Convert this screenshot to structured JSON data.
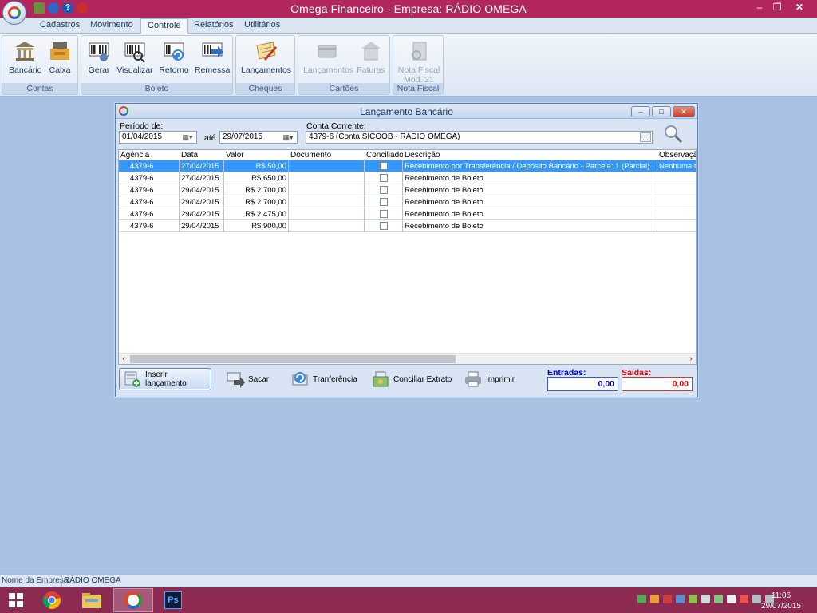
{
  "app": {
    "title": "Omega Financeiro - Empresa: RÁDIO OMEGA",
    "window_controls": [
      "–",
      "❐",
      "✕"
    ]
  },
  "menu": {
    "tabs": [
      {
        "label": "Cadastros",
        "active": false
      },
      {
        "label": "Movimento",
        "active": false
      },
      {
        "label": "Controle",
        "active": true
      },
      {
        "label": "Relatórios",
        "active": false
      },
      {
        "label": "Utilitários",
        "active": false
      }
    ]
  },
  "ribbon": {
    "groups": [
      {
        "label": "Contas",
        "buttons": [
          {
            "label": "Bancário",
            "icon": "bank-icon"
          },
          {
            "label": "Caixa",
            "icon": "cash-register-icon"
          }
        ]
      },
      {
        "label": "Boleto",
        "buttons": [
          {
            "label": "Gerar",
            "icon": "barcode-gear-icon"
          },
          {
            "label": "Visualizar",
            "icon": "barcode-magnifier-icon"
          },
          {
            "label": "Retorno",
            "icon": "barcode-refresh-icon"
          },
          {
            "label": "Remessa",
            "icon": "barcode-arrow-icon"
          }
        ]
      },
      {
        "label": "Cheques",
        "buttons": [
          {
            "label": "Lançamentos",
            "icon": "check-pen-icon"
          }
        ]
      },
      {
        "label": "Cartões",
        "buttons": [
          {
            "label": "Lançamentos",
            "icon": "card-icon",
            "disabled": true
          },
          {
            "label": "Faturas",
            "icon": "invoice-icon",
            "disabled": true
          }
        ]
      },
      {
        "label": "Nota Fiscal",
        "buttons": [
          {
            "label": "Nota Fiscal",
            "label2": "Mod. 21",
            "icon": "tax-note-icon",
            "disabled": true
          }
        ]
      }
    ]
  },
  "dialog": {
    "title": "Lançamento Bancário",
    "periodo_label": "Período de:",
    "periodo_de": "01/04/2015",
    "ate_label": "até",
    "periodo_ate": "29/07/2015",
    "conta_label": "Conta Corrente:",
    "conta_value": "4379-6 (Conta SICOOB - RÁDIO OMEGA)",
    "conta_button": "...",
    "columns": [
      "Agência",
      "Data",
      "Valor",
      "Documento",
      "Conciliado",
      "Descrição",
      "Observação"
    ],
    "rows": [
      {
        "agencia": "4379-6",
        "data": "27/04/2015",
        "valor": "R$ 50,00",
        "documento": "",
        "conciliado": false,
        "descricao": "Recebimento por Transferência  / Depósito Bancário - Parcela: 1 (Parcial)",
        "observacao": "Nenhuma m",
        "selected": true
      },
      {
        "agencia": "4379-6",
        "data": "27/04/2015",
        "valor": "R$ 650,00",
        "documento": "",
        "conciliado": false,
        "descricao": "Recebimento de Boleto",
        "observacao": "",
        "selected": false
      },
      {
        "agencia": "4379-6",
        "data": "29/04/2015",
        "valor": "R$ 2.700,00",
        "documento": "",
        "conciliado": false,
        "descricao": "Recebimento de Boleto",
        "observacao": "",
        "selected": false
      },
      {
        "agencia": "4379-6",
        "data": "29/04/2015",
        "valor": "R$ 2.700,00",
        "documento": "",
        "conciliado": false,
        "descricao": "Recebimento de Boleto",
        "observacao": "",
        "selected": false
      },
      {
        "agencia": "4379-6",
        "data": "29/04/2015",
        "valor": "R$ 2.475,00",
        "documento": "",
        "conciliado": false,
        "descricao": "Recebimento de Boleto",
        "observacao": "",
        "selected": false
      },
      {
        "agencia": "4379-6",
        "data": "29/04/2015",
        "valor": "R$ 900,00",
        "documento": "",
        "conciliado": false,
        "descricao": "Recebimento de Boleto",
        "observacao": "",
        "selected": false
      }
    ],
    "buttons": {
      "inserir": "Inserir lançamento",
      "sacar": "Sacar",
      "transferencia": "Tranferência",
      "conciliar": "Conciliar Extrato",
      "imprimir": "Imprimir"
    },
    "entradas_label": "Entradas:",
    "entradas_value": "0,00",
    "saidas_label": "Saídas:",
    "saidas_value": "0,00"
  },
  "status": {
    "label": "Nome da Empresa:",
    "value": "RÁDIO OMEGA"
  },
  "taskbar": {
    "time": "11:06",
    "date": "29/07/2015"
  },
  "colors": {
    "titlebar": "#b1265e",
    "taskbar": "#8d2a52",
    "selection": "#3399ff",
    "entradas": "#0000cc",
    "saidas": "#dd0000",
    "workspace": "#a9c2e3"
  }
}
